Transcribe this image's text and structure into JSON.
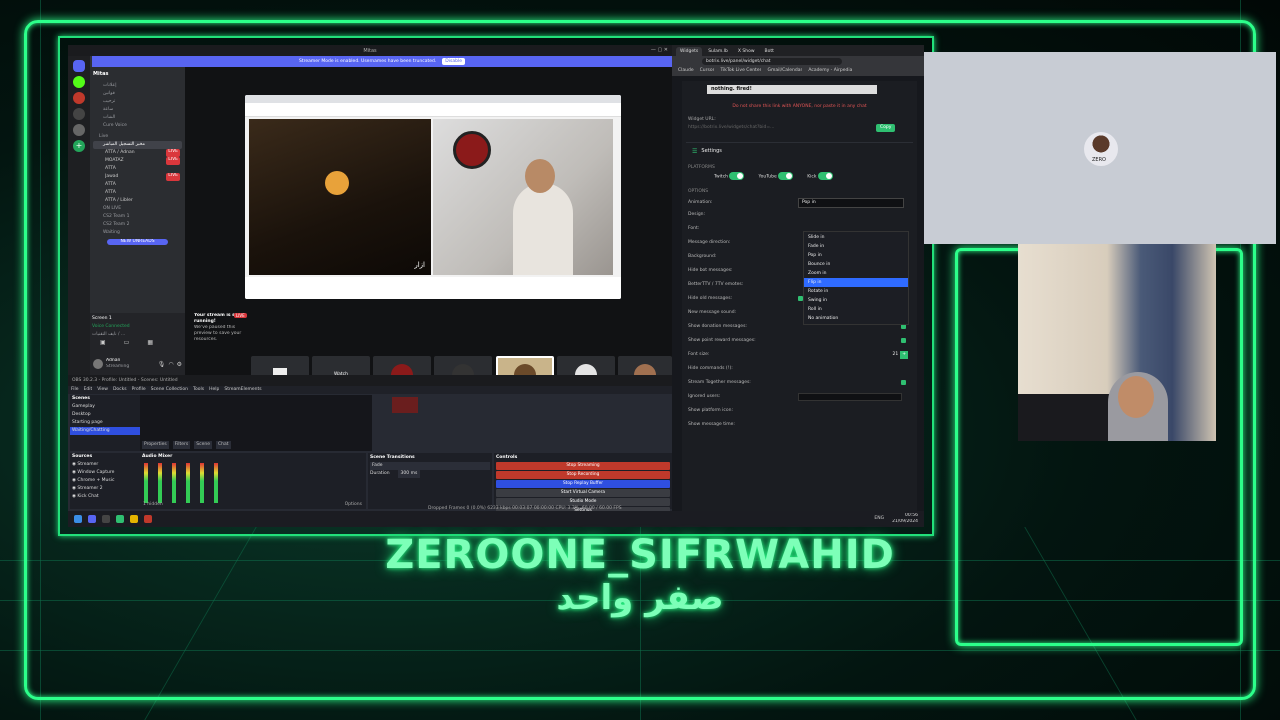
{
  "discord": {
    "window_title": "Mitas",
    "banner": "Streamer Mode is enabled. Usernames have been truncated.",
    "banner_button": "Disable",
    "server_name": "Mitas",
    "channels": [
      "إعلانات",
      "قوانين",
      "ترحيب",
      "ساعة",
      "الشات",
      "Cure Voice"
    ],
    "live_header": "Live",
    "voice_channel": "مخبر التسجيل المباشر",
    "members": [
      {
        "name": "ATTA / Adnan",
        "live": true
      },
      {
        "name": "MOATAZ",
        "live": true
      },
      {
        "name": "ATTA",
        "live": false
      },
      {
        "name": "Jawad",
        "live": true
      },
      {
        "name": "ATTA",
        "live": false
      },
      {
        "name": "ATTA",
        "live": false
      },
      {
        "name": "ATTA / Libler",
        "live": false
      }
    ],
    "on_live": "ON LIVE",
    "team_channels": [
      "CS2 Team 1",
      "CS2 Team 2",
      "Waiting"
    ],
    "new_unreads": "NEW UNREADS",
    "screen_share": "Screen 1",
    "screen_share_sub": "in a Voice",
    "voice_connected": "Voice Connected",
    "voice_sub": "نايف التقنيات / ...",
    "user_name": "Adnan",
    "user_status": "Streaming",
    "stream_paused_title": "Your stream is still running!",
    "stream_paused_text": "We've paused this preview to save your resources.",
    "live_badge": "LIVE",
    "watch_label": "Watch",
    "video_name": "ازار"
  },
  "obs": {
    "title": "OBS 30.2.3 - Profile: Untitled - Scenes: Untitled",
    "menu": [
      "File",
      "Edit",
      "View",
      "Docks",
      "Profile",
      "Scene Collection",
      "Tools",
      "Help",
      "StreamElements"
    ],
    "scenes_header": "Scenes",
    "scenes": [
      "Gameplay",
      "Desktop",
      "Starting page",
      "Waiting/Chatting"
    ],
    "sources_header": "Sources",
    "sources": [
      "Streamer",
      "Window Capture",
      "Chrome + Music",
      "Streamer 2",
      "Kick Chat"
    ],
    "audio_header": "Audio Mixer",
    "transitions_header": "Scene Transitions",
    "transition_value": "Fade",
    "duration_label": "Duration",
    "duration_value": "300 ms",
    "controls_header": "Controls",
    "controls": [
      {
        "label": "Stop Streaming",
        "color": "#c0392b"
      },
      {
        "label": "Stop Recording",
        "color": "#c0392b"
      },
      {
        "label": "Stop Replay Buffer",
        "color": "#2f4fe0"
      },
      {
        "label": "Start Virtual Camera",
        "color": "#3a3c42"
      },
      {
        "label": "Studio Mode",
        "color": "#3a3c42"
      },
      {
        "label": "Settings",
        "color": "#3a3c42"
      },
      {
        "label": "Exit",
        "color": "#3a3c42"
      }
    ],
    "donate": "StreamElements Live Support",
    "status_bar": "Dropped Frames 0 (0.0%)   6233 kbps   00:03:07   00:00:00   CPU: 3.3%, 60.00 / 60.00 FPS",
    "tabs": [
      "Properties",
      "Filters",
      "Scene",
      "Chat"
    ],
    "hidden": "1 hidden",
    "options": "Options"
  },
  "browser": {
    "tabs": [
      "Widgets",
      "Sulam.lb",
      "X Show",
      "Bott"
    ],
    "url": "botrix.live/panel/widget/chat",
    "bookmarks": [
      "Claude",
      "Cursor",
      "TikTok Live Center",
      "Gmail/Calendar",
      "Academy - Airpedia"
    ],
    "nothing_fired": "nothing. fired!",
    "warning": "Do not share this link with ANYONE, nor paste it in any chat",
    "widget_url_label": "Widget URL:",
    "widget_url_value": "https://botrix.live/widgets/chat?bid=...",
    "copy_label": "Copy",
    "settings_title": "Settings",
    "platforms_label": "PLATFORMS",
    "platforms": [
      "Twitch",
      "YouTube",
      "Kick"
    ],
    "options_label": "OPTIONS",
    "animation_label": "Animation:",
    "animation_value": "Pop in",
    "animation_options": [
      "Slide in",
      "Fade in",
      "Pop in",
      "Bounce in",
      "Zoom in",
      "Flip in",
      "Rotate in",
      "Swing in",
      "Roll in",
      "No animation"
    ],
    "animation_selected": "Flip in",
    "rows": [
      {
        "label": "Design:",
        "control": "none"
      },
      {
        "label": "Font:",
        "control": "none"
      },
      {
        "label": "Message direction:",
        "control": "none"
      },
      {
        "label": "Background:",
        "control": "none"
      },
      {
        "label": "Hide bot messages:",
        "control": "none"
      },
      {
        "label": "BetterTTV / 7TV emotes:",
        "control": "check"
      },
      {
        "label": "Hide old messages:",
        "control": "slider"
      },
      {
        "label": "New message sound:",
        "control": "none"
      },
      {
        "label": "Show donation messages:",
        "control": "check"
      },
      {
        "label": "Show point reward messages:",
        "control": "check"
      },
      {
        "label": "Font size:",
        "control": "number"
      },
      {
        "label": "Hide commands (!):",
        "control": "none"
      },
      {
        "label": "Stream Together messages:",
        "control": "check"
      },
      {
        "label": "Ignored users:",
        "control": "input"
      },
      {
        "label": "Show platform icon:",
        "control": "none"
      },
      {
        "label": "Show message time:",
        "control": "none"
      }
    ],
    "hide_old_seconds": "15 seconds",
    "font_size_value": "21"
  },
  "taskbar": {
    "time": "00:56",
    "date": "21/09/2024",
    "lang": "ENG"
  },
  "overlay": {
    "title": "ZEROONE_SIFRWAHID",
    "subtitle": "صفر واحد",
    "cam_label": "ZERO"
  },
  "colors": {
    "neon": "#2cff8a",
    "discord_purple": "#5865f2",
    "accent_green": "#2fbf71",
    "select_blue": "#2f6bff"
  }
}
